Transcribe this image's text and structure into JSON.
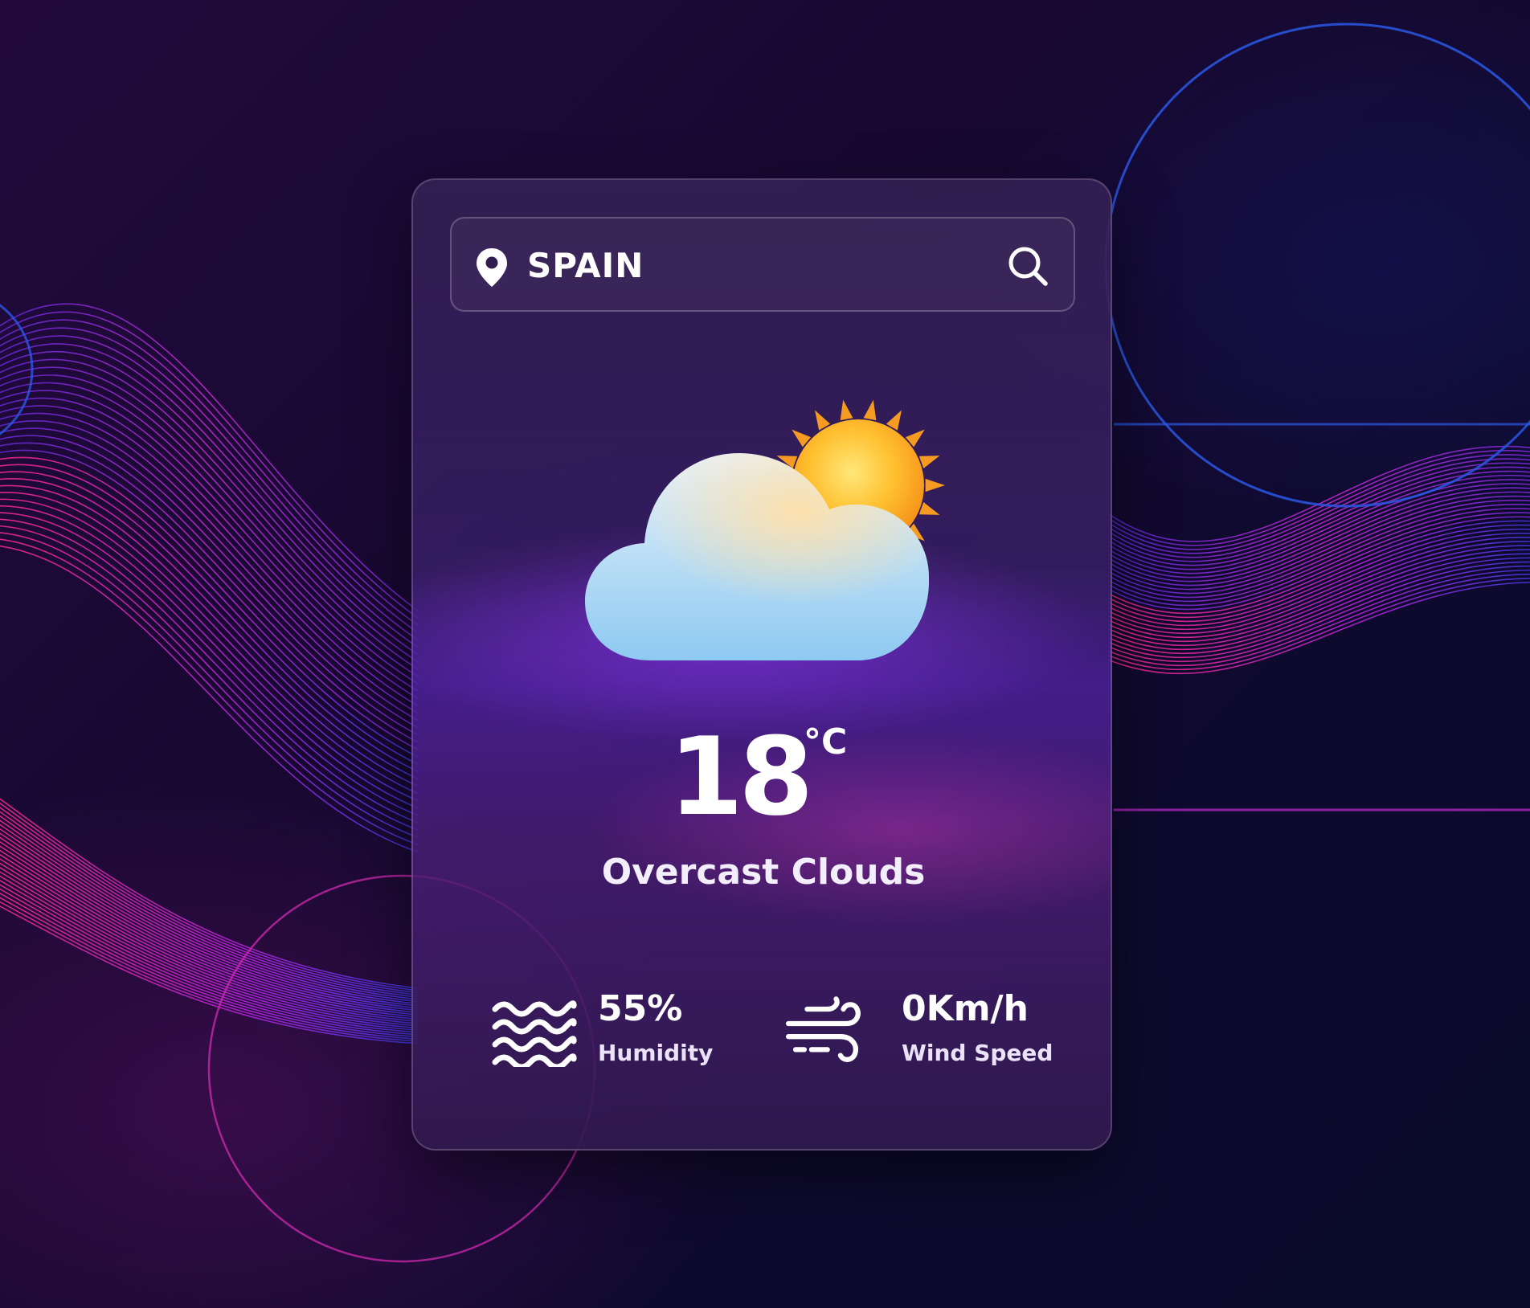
{
  "search": {
    "value": "SPAIN",
    "placeholder": ""
  },
  "weather": {
    "temperature": "18",
    "unit": "°C",
    "condition": "Overcast Clouds",
    "icon": "cloud-sun-icon"
  },
  "details": {
    "humidity": {
      "value": "55%",
      "label": "Humidity",
      "icon": "waves-icon"
    },
    "wind": {
      "value": "0Km/h",
      "label": "Wind Speed",
      "icon": "wind-icon"
    }
  },
  "colors": {
    "background": "#170830",
    "accent_pink": "#e0259a",
    "accent_blue": "#2a5cf0",
    "card_border": "#5a4a78",
    "text": "#ffffff"
  }
}
